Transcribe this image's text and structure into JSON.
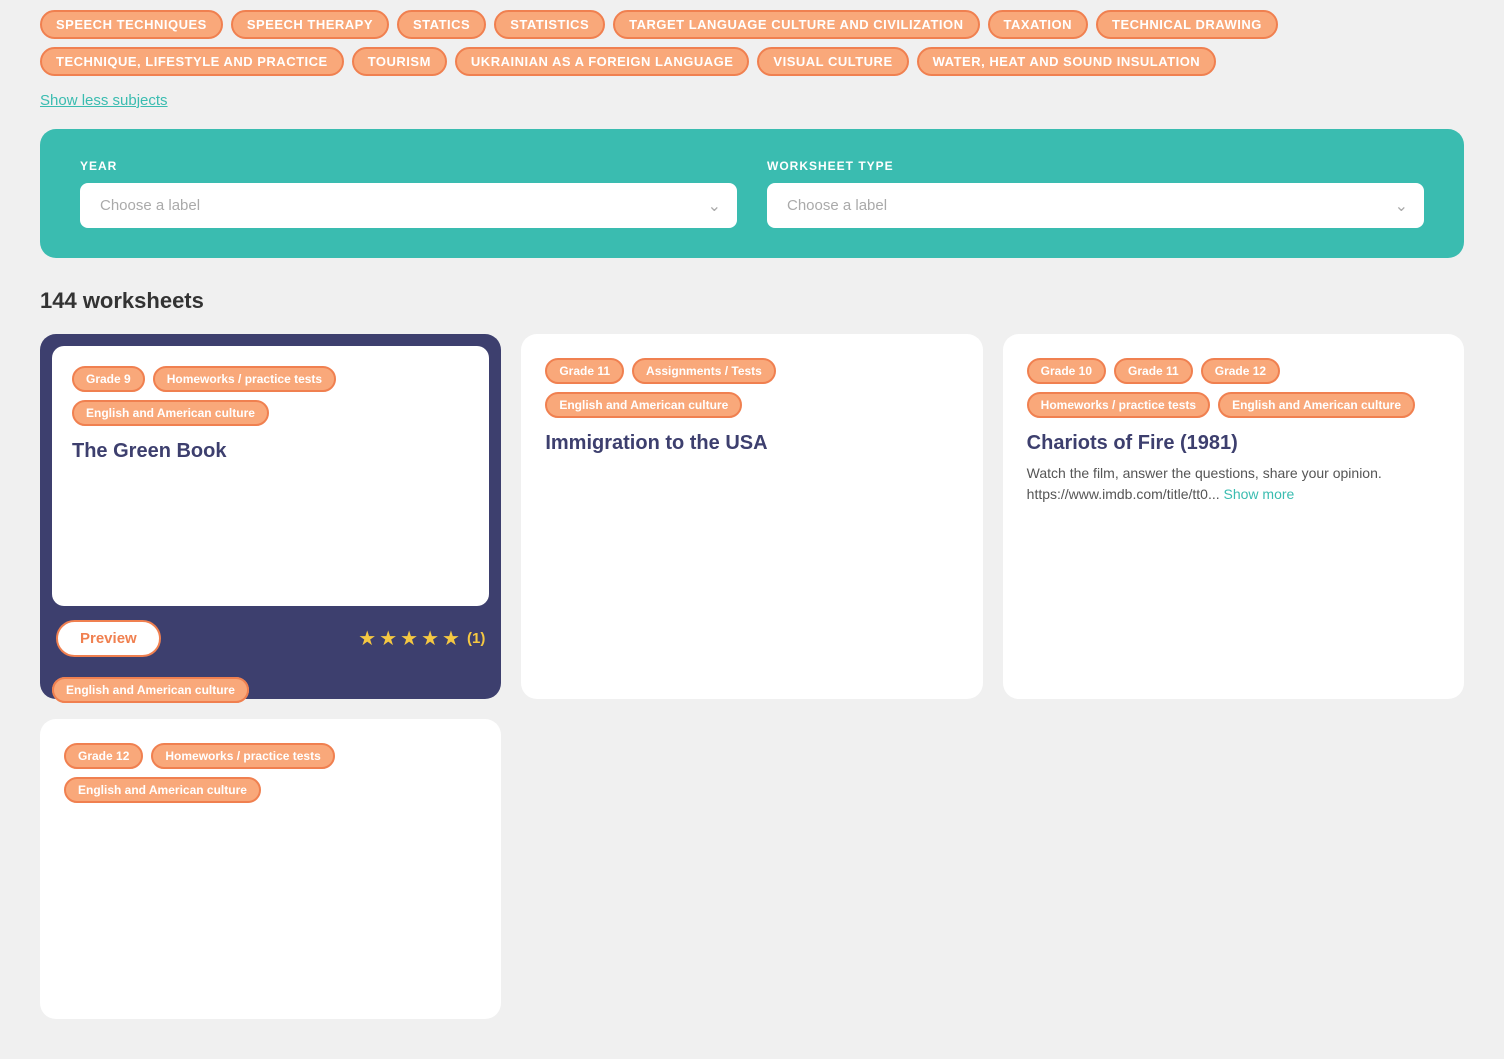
{
  "subjects": {
    "tags": [
      "SPEECH TECHNIQUES",
      "SPEECH THERAPY",
      "STATICS",
      "STATISTICS",
      "TARGET LANGUAGE CULTURE AND CIVILIZATION",
      "TAXATION",
      "TECHNICAL DRAWING",
      "TECHNIQUE, LIFESTYLE AND PRACTICE",
      "TOURISM",
      "UKRAINIAN AS A FOREIGN LANGUAGE",
      "VISUAL CULTURE",
      "WATER, HEAT AND SOUND INSULATION"
    ],
    "show_less_label": "Show less subjects"
  },
  "filters": {
    "year_label": "YEAR",
    "year_placeholder": "Choose a label",
    "worksheet_type_label": "WORKSHEET TYPE",
    "worksheet_type_placeholder": "Choose a label"
  },
  "worksheets": {
    "count_label": "144 worksheets",
    "cards": [
      {
        "id": 1,
        "featured": true,
        "tags": [
          "Grade 9",
          "Homeworks / practice tests",
          "English and American culture"
        ],
        "title": "The Green Book",
        "description": "",
        "preview_label": "Preview",
        "stars": 5,
        "rating_count": "(1)",
        "bottom_tag": "English and American culture"
      },
      {
        "id": 2,
        "featured": false,
        "tags": [
          "Grade 11",
          "Assignments / Tests",
          "English and American culture"
        ],
        "title": "Immigration to the USA",
        "description": "",
        "bottom_tags": []
      },
      {
        "id": 3,
        "featured": false,
        "tags": [
          "Grade 10",
          "Grade 11",
          "Grade 12",
          "Homeworks / practice tests",
          "English and American culture"
        ],
        "title": "Chariots of Fire (1981)",
        "description": "Watch the film, answer the questions, share your opinion. https://www.imdb.com/title/tt0...",
        "show_more_label": "Show more"
      },
      {
        "id": 4,
        "featured": false,
        "tags": [
          "Grade 12",
          "Homeworks / practice tests",
          "English and American culture"
        ],
        "title": "",
        "description": ""
      }
    ]
  }
}
